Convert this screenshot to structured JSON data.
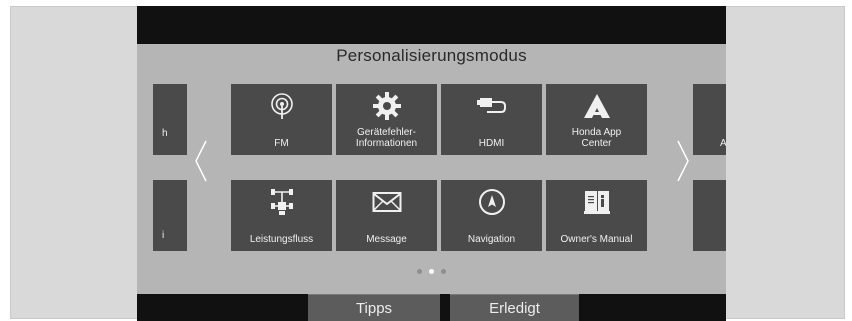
{
  "header": {
    "title": "Personalisierungsmodus"
  },
  "apps_row1": [
    {
      "label": "FM",
      "icon": "radio-antenna-icon"
    },
    {
      "label": "Gerätefehler-\nInformationen",
      "icon": "gear-icon"
    },
    {
      "label": "HDMI",
      "icon": "hdmi-plug-icon"
    },
    {
      "label": "Honda App\nCenter",
      "icon": "honda-app-center-icon"
    }
  ],
  "apps_row2": [
    {
      "label": "Leistungsfluss",
      "icon": "power-flow-icon"
    },
    {
      "label": "Message",
      "icon": "envelope-icon"
    },
    {
      "label": "Navigation",
      "icon": "compass-icon"
    },
    {
      "label": "Owner's Manual",
      "icon": "manual-book-icon"
    }
  ],
  "partial_left": {
    "row1_char": "h",
    "row2_char": "i"
  },
  "partial_right": {
    "row1_char": "A"
  },
  "pagination": {
    "pages": 3,
    "current_index": 1
  },
  "footer": {
    "tips_label": "Tipps",
    "done_label": "Erledigt"
  },
  "colors": {
    "panel": "#b5b5b5",
    "tile": "#4a4a4a",
    "screen_bg": "#111111",
    "button": "#5c5c5c"
  }
}
